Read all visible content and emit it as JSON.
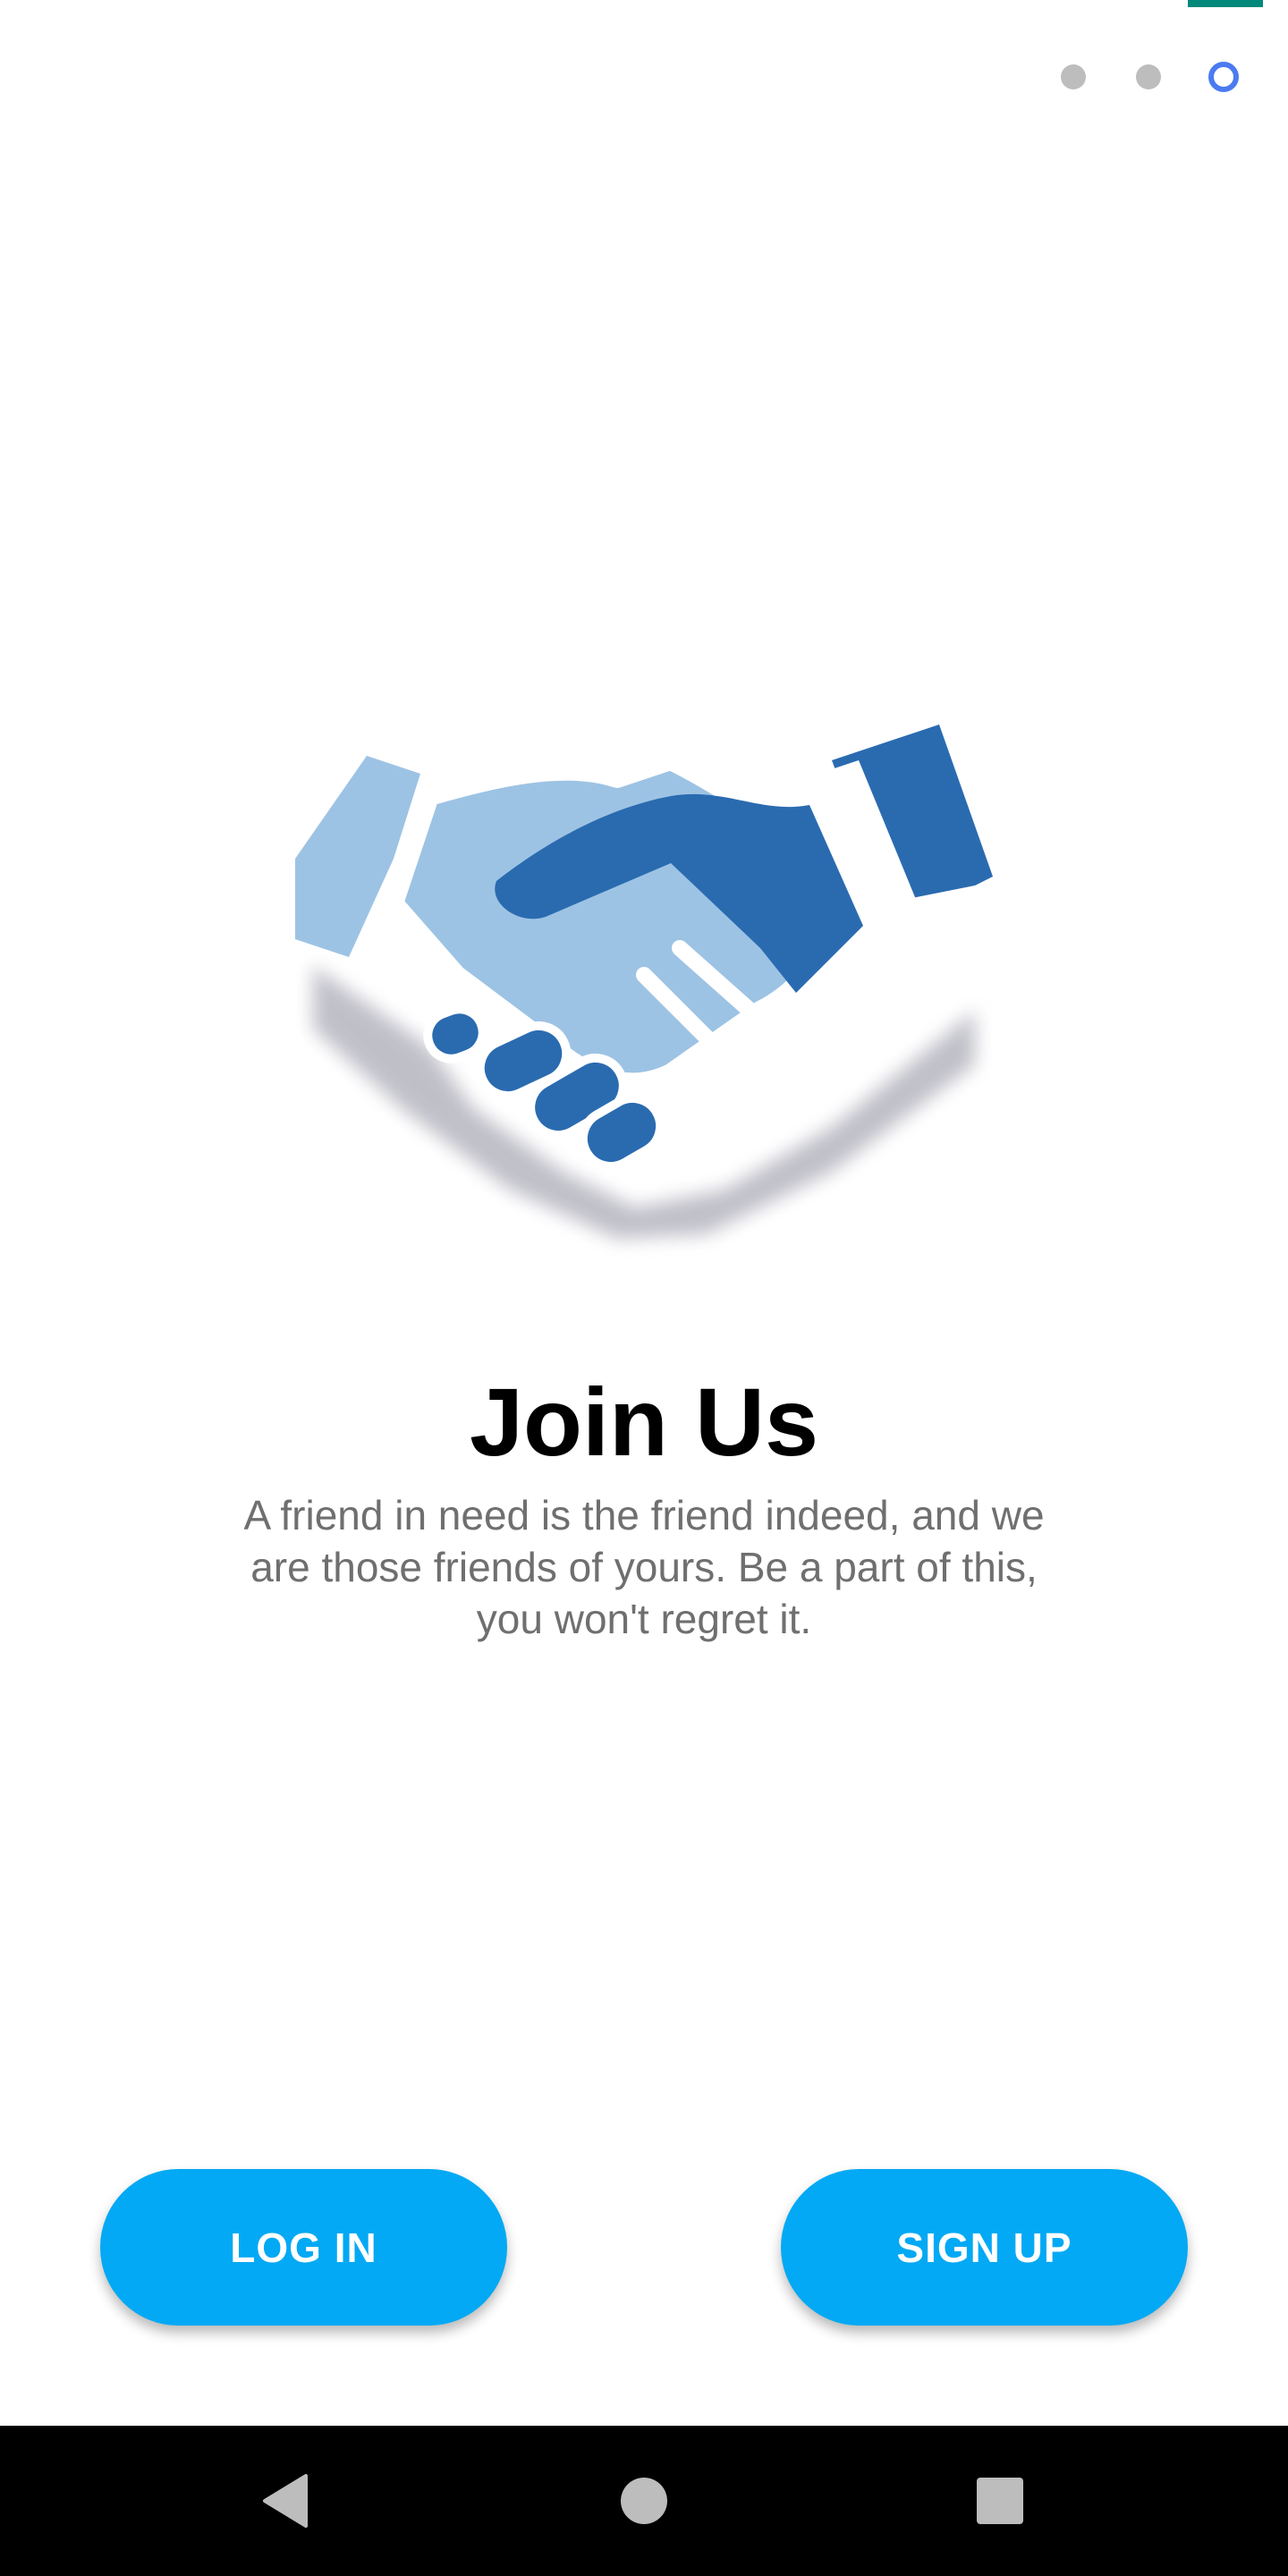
{
  "status_bar": {
    "accent_color": "#00897B"
  },
  "pager": {
    "page_count": 3,
    "current_page": 3,
    "active_color": "#4A7BF0",
    "inactive_color": "#BDBDBD"
  },
  "illustration": {
    "icon": "handshake-icon",
    "colors": {
      "light": "#9DC3E4",
      "dark": "#2A6BB0"
    }
  },
  "content": {
    "title": "Join Us",
    "description": "A friend in need is the friend indeed, and we are those friends of yours. Be a part of this, you won't regret it."
  },
  "actions": {
    "login_label": "LOG IN",
    "signup_label": "SIGN UP",
    "button_color": "#03A9F4"
  },
  "navigation_bar": {
    "back_icon": "back-triangle-icon",
    "home_icon": "home-circle-icon",
    "recents_icon": "recents-square-icon"
  }
}
